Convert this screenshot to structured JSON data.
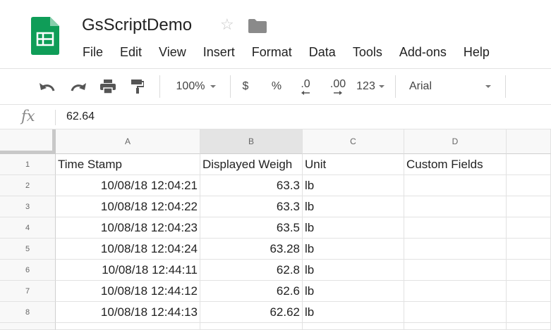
{
  "app": {
    "title": "GsScriptDemo",
    "brand_color": "#0f9d58"
  },
  "menu": [
    "File",
    "Edit",
    "View",
    "Insert",
    "Format",
    "Data",
    "Tools",
    "Add-ons",
    "Help"
  ],
  "toolbar": {
    "zoom": "100%",
    "currency": "$",
    "percent": "%",
    "decrease_decimals": ".0",
    "increase_decimals": ".00",
    "more_formats": "123",
    "font": "Arial"
  },
  "formula_bar": {
    "fx_label": "fx",
    "value": "62.64"
  },
  "sheet": {
    "columns": [
      "A",
      "B",
      "C",
      "D"
    ],
    "rows": [
      {
        "num": "1",
        "a": "Time Stamp",
        "b": "Displayed Weigh",
        "c": "Unit",
        "d": "Custom Fields"
      },
      {
        "num": "2",
        "a": "10/08/18 12:04:21",
        "b": "63.3",
        "c": "lb",
        "d": ""
      },
      {
        "num": "3",
        "a": "10/08/18 12:04:22",
        "b": "63.3",
        "c": "lb",
        "d": ""
      },
      {
        "num": "4",
        "a": "10/08/18 12:04:23",
        "b": "63.5",
        "c": "lb",
        "d": ""
      },
      {
        "num": "5",
        "a": "10/08/18 12:04:24",
        "b": "63.28",
        "c": "lb",
        "d": ""
      },
      {
        "num": "6",
        "a": "10/08/18 12:44:11",
        "b": "62.8",
        "c": "lb",
        "d": ""
      },
      {
        "num": "7",
        "a": "10/08/18 12:44:12",
        "b": "62.6",
        "c": "lb",
        "d": ""
      },
      {
        "num": "8",
        "a": "10/08/18 12:44:13",
        "b": "62.62",
        "c": "lb",
        "d": ""
      }
    ]
  }
}
